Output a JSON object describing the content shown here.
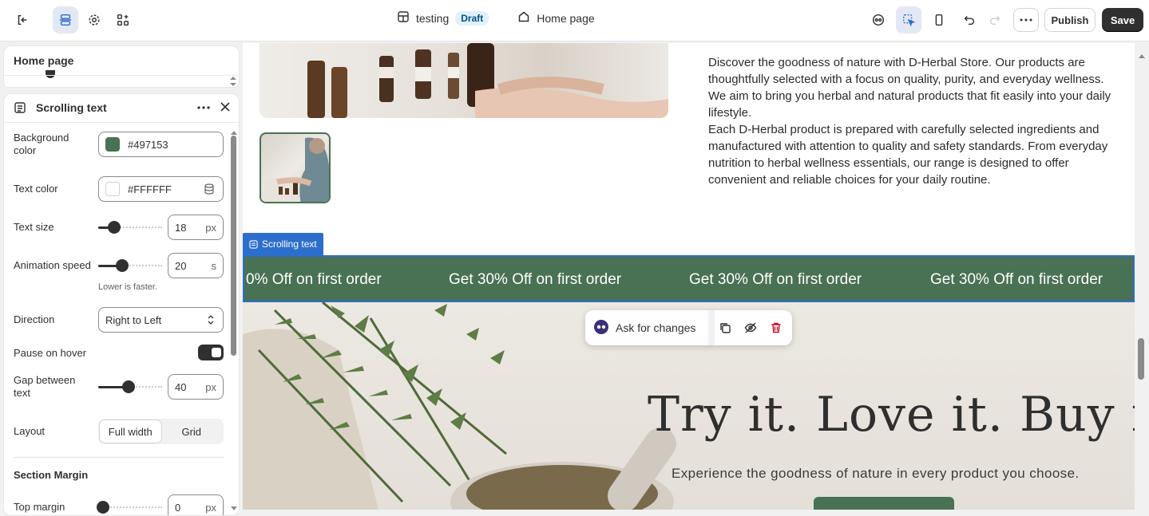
{
  "topbar": {
    "store_name": "testing",
    "status_badge": "Draft",
    "page_name": "Home page",
    "publish_label": "Publish",
    "save_label": "Save"
  },
  "sidebar": {
    "page_title": "Home page",
    "section_title": "Scrolling text",
    "fields": {
      "background_color": {
        "label": "Background color",
        "value": "#497153"
      },
      "text_color": {
        "label": "Text color",
        "value": "#FFFFFF"
      },
      "text_size": {
        "label": "Text size",
        "value": "18",
        "unit": "px",
        "level": 0.18
      },
      "animation_speed": {
        "label": "Animation speed",
        "value": "20",
        "unit": "s",
        "hint": "Lower is faster.",
        "level": 0.3
      },
      "direction": {
        "label": "Direction",
        "value": "Right to Left"
      },
      "pause_on_hover": {
        "label": "Pause on hover",
        "on": true
      },
      "gap": {
        "label": "Gap between text",
        "value": "40",
        "unit": "px",
        "level": 0.4
      },
      "layout": {
        "label": "Layout",
        "options": [
          "Full width",
          "Grid"
        ],
        "selected": "Full width"
      },
      "section_margin": {
        "heading": "Section Margin"
      },
      "top_margin": {
        "label": "Top margin",
        "value": "0",
        "unit": "px",
        "level": 0
      }
    }
  },
  "canvas": {
    "description_p1": "Discover the goodness of nature with D-Herbal Store. Our products are thoughtfully selected with a focus on quality, purity, and everyday wellness. We aim to bring you herbal and natural products that fit easily into your daily lifestyle.",
    "description_p2": "Each D-Herbal product is prepared with carefully selected ingredients and manufactured with attention to quality and safety standards. From everyday nutrition to herbal wellness essentials, our range is designed to offer convenient and reliable choices for your daily routine.",
    "selection_label": "Scrolling text",
    "marquee_items": [
      "0% Off on first order",
      "Get 30% Off on first order",
      "Get 30% Off on first order",
      "Get 30% Off on first order"
    ],
    "hero_title": "Try it. Love it. Buy it.",
    "hero_subtitle": "Experience the goodness of nature in every product you choose.",
    "ask_for_changes": "Ask for changes"
  },
  "colors": {
    "brand_green": "#497153",
    "selection_blue": "#2c6ecb",
    "delete_red": "#c70a24"
  }
}
